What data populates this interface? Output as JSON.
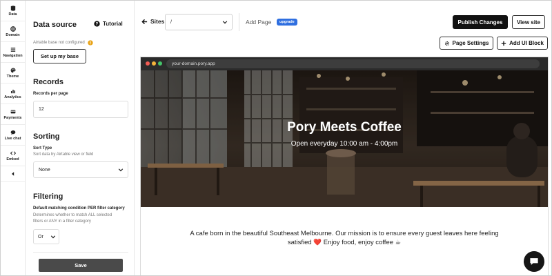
{
  "rail": {
    "items": [
      {
        "label": "Data",
        "icon": "database-icon"
      },
      {
        "label": "Domain",
        "icon": "globe-icon"
      },
      {
        "label": "Navigation",
        "icon": "menu-icon"
      },
      {
        "label": "Theme",
        "icon": "palette-icon"
      },
      {
        "label": "Analytics",
        "icon": "chart-icon"
      },
      {
        "label": "Payments",
        "icon": "credit-card-icon"
      },
      {
        "label": "Live chat",
        "icon": "chat-icon"
      },
      {
        "label": "Embed",
        "icon": "code-icon"
      }
    ]
  },
  "panel": {
    "title": "Data source",
    "tutorial_label": "Tutorial",
    "airtable_status": "Airtable base not configured",
    "setup_button": "Set up my base",
    "records": {
      "heading": "Records",
      "per_page_label": "Records per page",
      "per_page_value": "12"
    },
    "sorting": {
      "heading": "Sorting",
      "sort_label": "Sort Type",
      "sort_help": "Sort data by Airtable view or field",
      "sort_value": "None"
    },
    "filtering": {
      "heading": "Filtering",
      "condition_label": "Default matching condition PER filter category",
      "condition_help_1": "Determines whether to match ALL selected",
      "condition_help_2": "filters or ANY in a filter category",
      "condition_value": "Or"
    },
    "save_button": "Save"
  },
  "topbar": {
    "sites_label": "Sites",
    "path_value": "/",
    "add_page_label": "Add Page",
    "upgrade_badge": "upgrade",
    "publish_button": "Publish Changes",
    "view_site_button": "View site",
    "page_settings_button": "Page Settings",
    "add_block_button": "Add UI Block"
  },
  "preview": {
    "url": "your-domain.pory.app",
    "hero_title": "Pory Meets Coffee",
    "hero_subtitle": "Open everyday 10:00 am - 4:00pm",
    "about_line_1": "A cafe born in the beautiful Southeast Melbourne. Our mission is to ensure every guest leaves here feeling",
    "about_line_2": "satisfied ❤️ Enjoy food, enjoy coffee ☕"
  },
  "colors": {
    "primary_dark": "#111111",
    "upgrade_badge": "#2f6fe0",
    "warning": "#e8a317",
    "browser_chrome": "#2b2b2b"
  }
}
